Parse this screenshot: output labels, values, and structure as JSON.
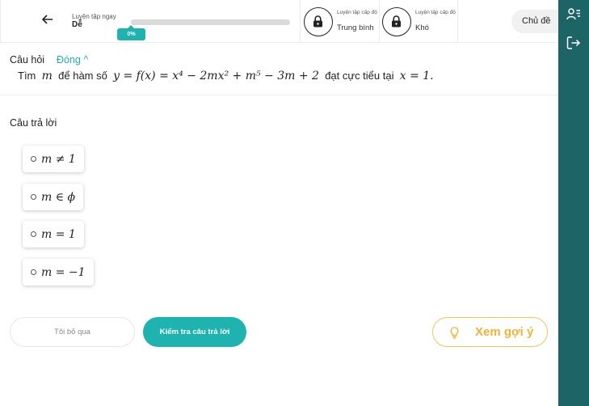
{
  "header": {
    "back_icon": "arrow-left-icon",
    "level_caption": "Luyện tập ngay",
    "level_name": "Dễ",
    "progress_label": "0%",
    "progress_value": 0,
    "locked_levels": [
      {
        "caption": "Luyện tập cấp độ",
        "name": "Trung bình",
        "icon": "lock-icon"
      },
      {
        "caption": "Luyện tập cấp độ",
        "name": "Khó",
        "icon": "lock-icon"
      }
    ],
    "topic_label": "Chủ đề"
  },
  "rail": {
    "icons": [
      "user-list-icon",
      "logout-icon"
    ]
  },
  "question": {
    "heading": "Câu hỏi",
    "toggle_label": "Đóng ^",
    "text_parts": [
      "Tìm",
      "m",
      "để hàm số",
      "y = f(x) = x⁴ − 2mx² + m⁵ − 3m + 2",
      "đạt cực tiểu tại",
      "x = 1."
    ]
  },
  "answers": {
    "heading": "Câu trả lời",
    "options": [
      "m ≠ 1",
      "m ∈ ϕ",
      "m = 1",
      "m = −1"
    ]
  },
  "actions": {
    "skip_label": "Tôi bỏ qua",
    "check_label": "Kiểm tra câu trả lời",
    "hint_label": "Xem gợi ý",
    "hint_icon": "lightbulb-icon"
  },
  "colors": {
    "accent": "#1fb3b0",
    "rail": "#1c6466",
    "hint": "#f5b335"
  }
}
